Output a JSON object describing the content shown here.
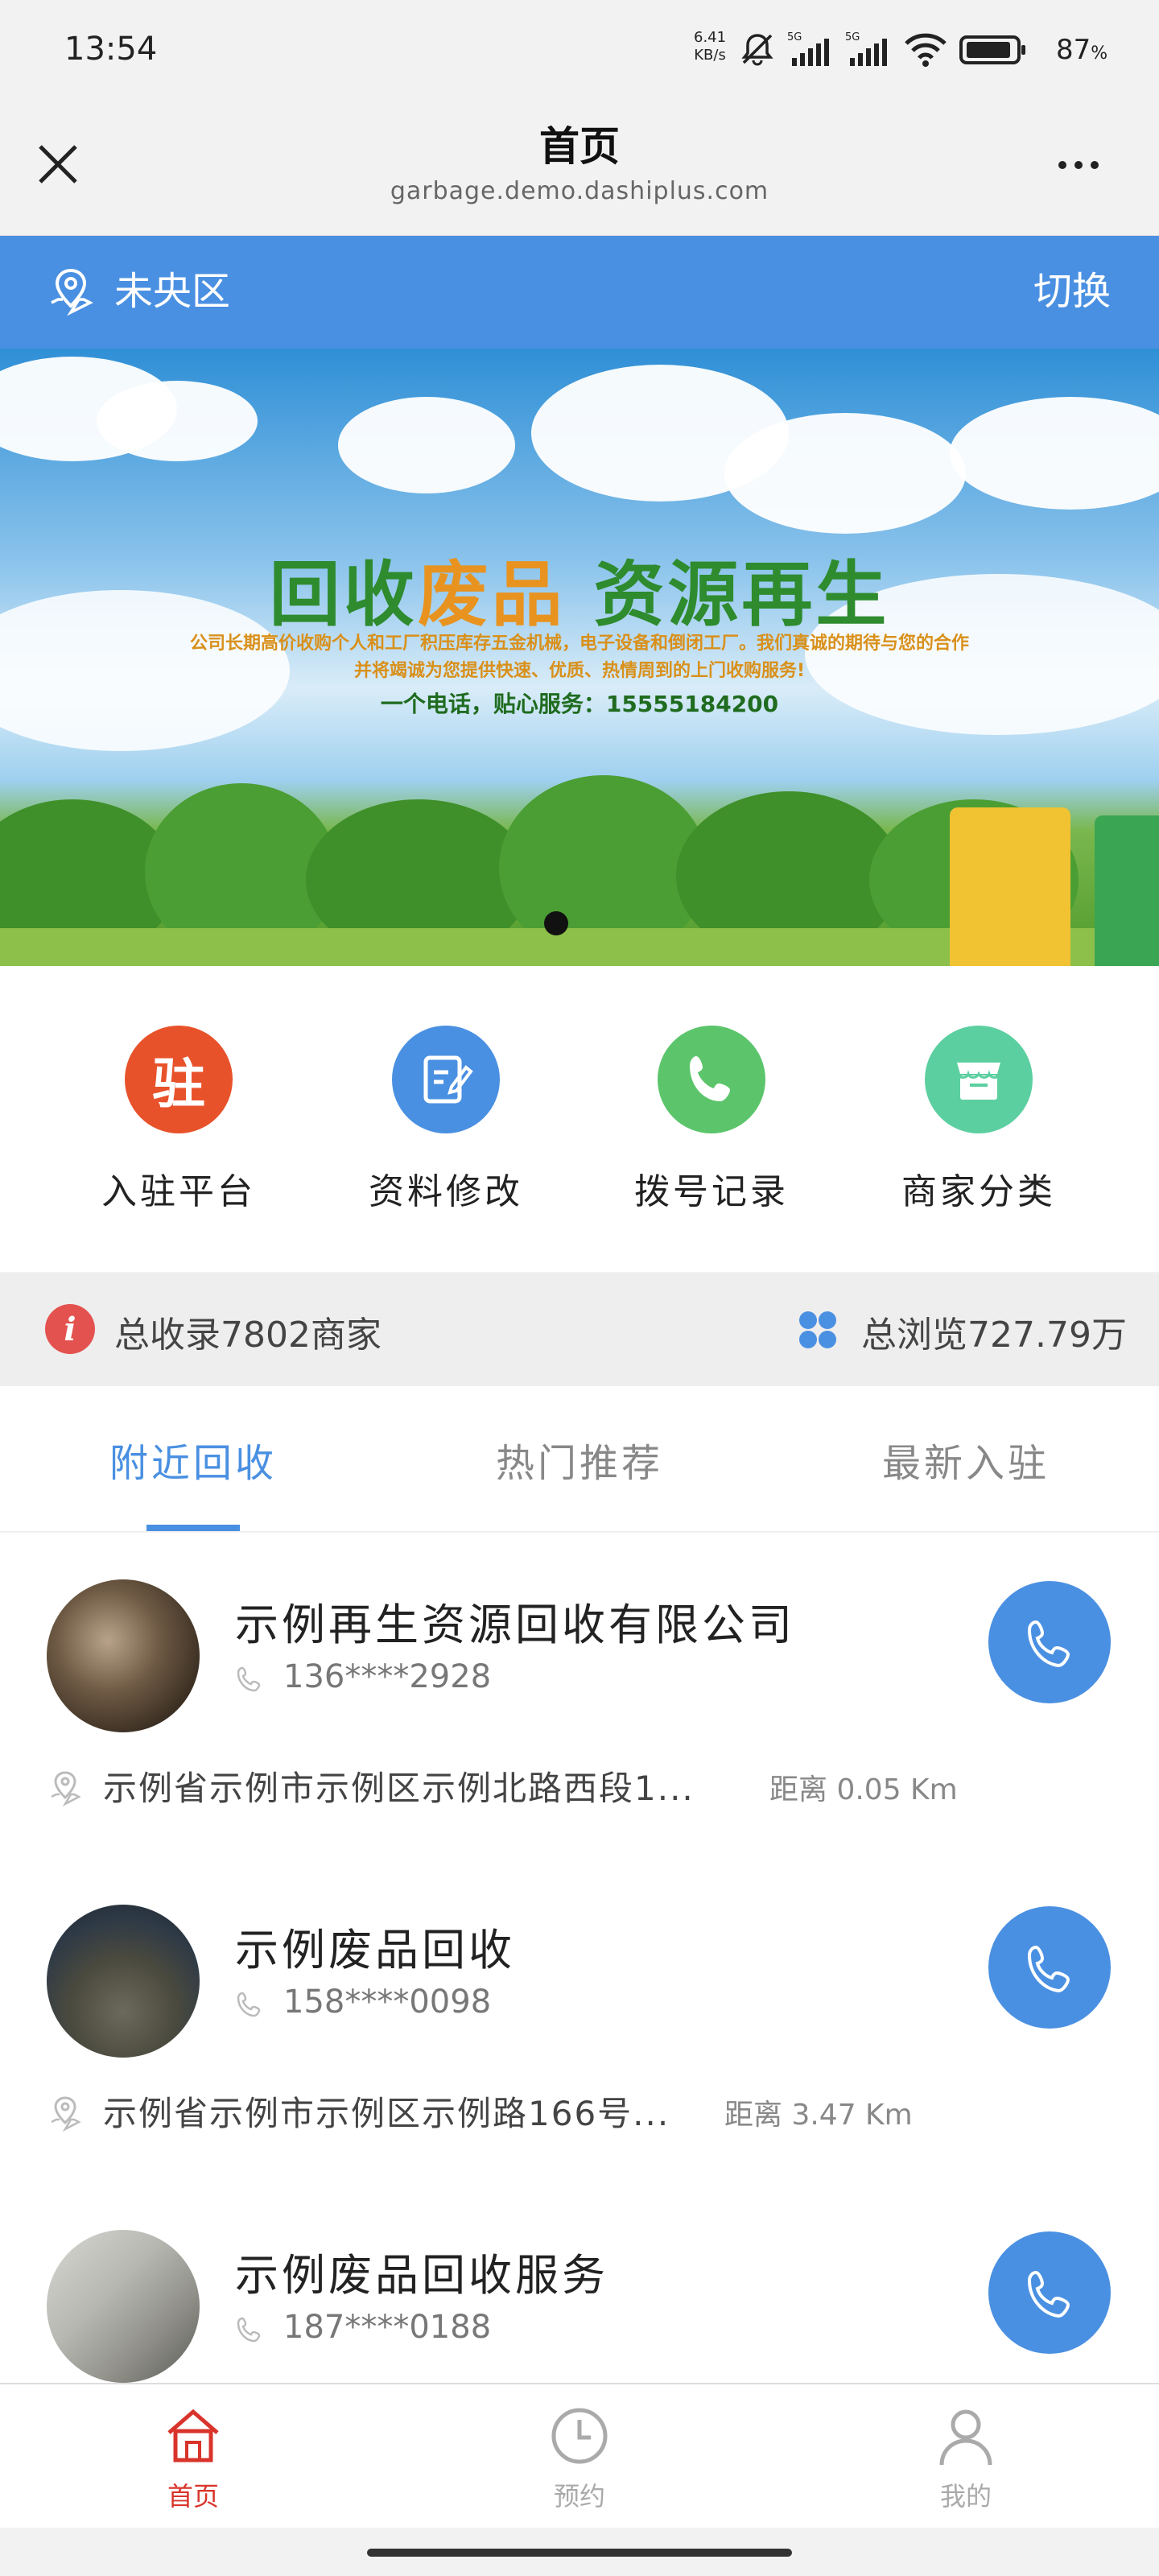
{
  "status_bar": {
    "time": "13:54",
    "net_speed_value": "6.41",
    "net_speed_unit": "KB/s",
    "battery": "87",
    "battery_unit": "%"
  },
  "nav": {
    "title": "首页",
    "url": "garbage.demo.dashiplus.com"
  },
  "location": {
    "name": "未央区",
    "switch_label": "切换"
  },
  "banner": {
    "title_part1": "回收",
    "title_part2": "废品",
    "title_part3": " 资源再生",
    "line1": "公司长期高价收购个人和工厂积压库存五金机械，电子设备和倒闭工厂。我们真诚的期待与您的合作",
    "line2": "并将竭诚为您提供快速、优质、热情周到的上门收购服务!",
    "phone_line": "一个电话，贴心服务：15555184200"
  },
  "actions": [
    {
      "label": "入驻平台",
      "icon": "station-icon",
      "color": "#e8522b"
    },
    {
      "label": "资料修改",
      "icon": "edit-icon",
      "color": "#4a90e2"
    },
    {
      "label": "拨号记录",
      "icon": "phone-icon",
      "color": "#5cc56b"
    },
    {
      "label": "商家分类",
      "icon": "store-icon",
      "color": "#5ccfa0"
    }
  ],
  "stats": {
    "total_merchants": "总收录7802商家",
    "total_views": "总浏览727.79万"
  },
  "tabs": [
    {
      "label": "附近回收",
      "active": true
    },
    {
      "label": "热门推荐",
      "active": false
    },
    {
      "label": "最新入驻",
      "active": false
    }
  ],
  "merchants": [
    {
      "name": "示例再生资源回收有限公司",
      "phone": "136****2928",
      "address": "示例省示例市示例区示例北路西段1...",
      "distance": "距离 0.05 Km"
    },
    {
      "name": "示例废品回收",
      "phone": "158****0098",
      "address": "示例省示例市示例区示例路166号...",
      "distance": "距离 3.47 Km"
    },
    {
      "name": "示例废品回收服务",
      "phone": "187****0188",
      "address": "",
      "distance": ""
    }
  ],
  "bottom_nav": [
    {
      "label": "首页",
      "active": true
    },
    {
      "label": "预约",
      "active": false
    },
    {
      "label": "我的",
      "active": false
    }
  ],
  "colors": {
    "accent": "#4a90e2",
    "active_nav": "#d9342b"
  }
}
